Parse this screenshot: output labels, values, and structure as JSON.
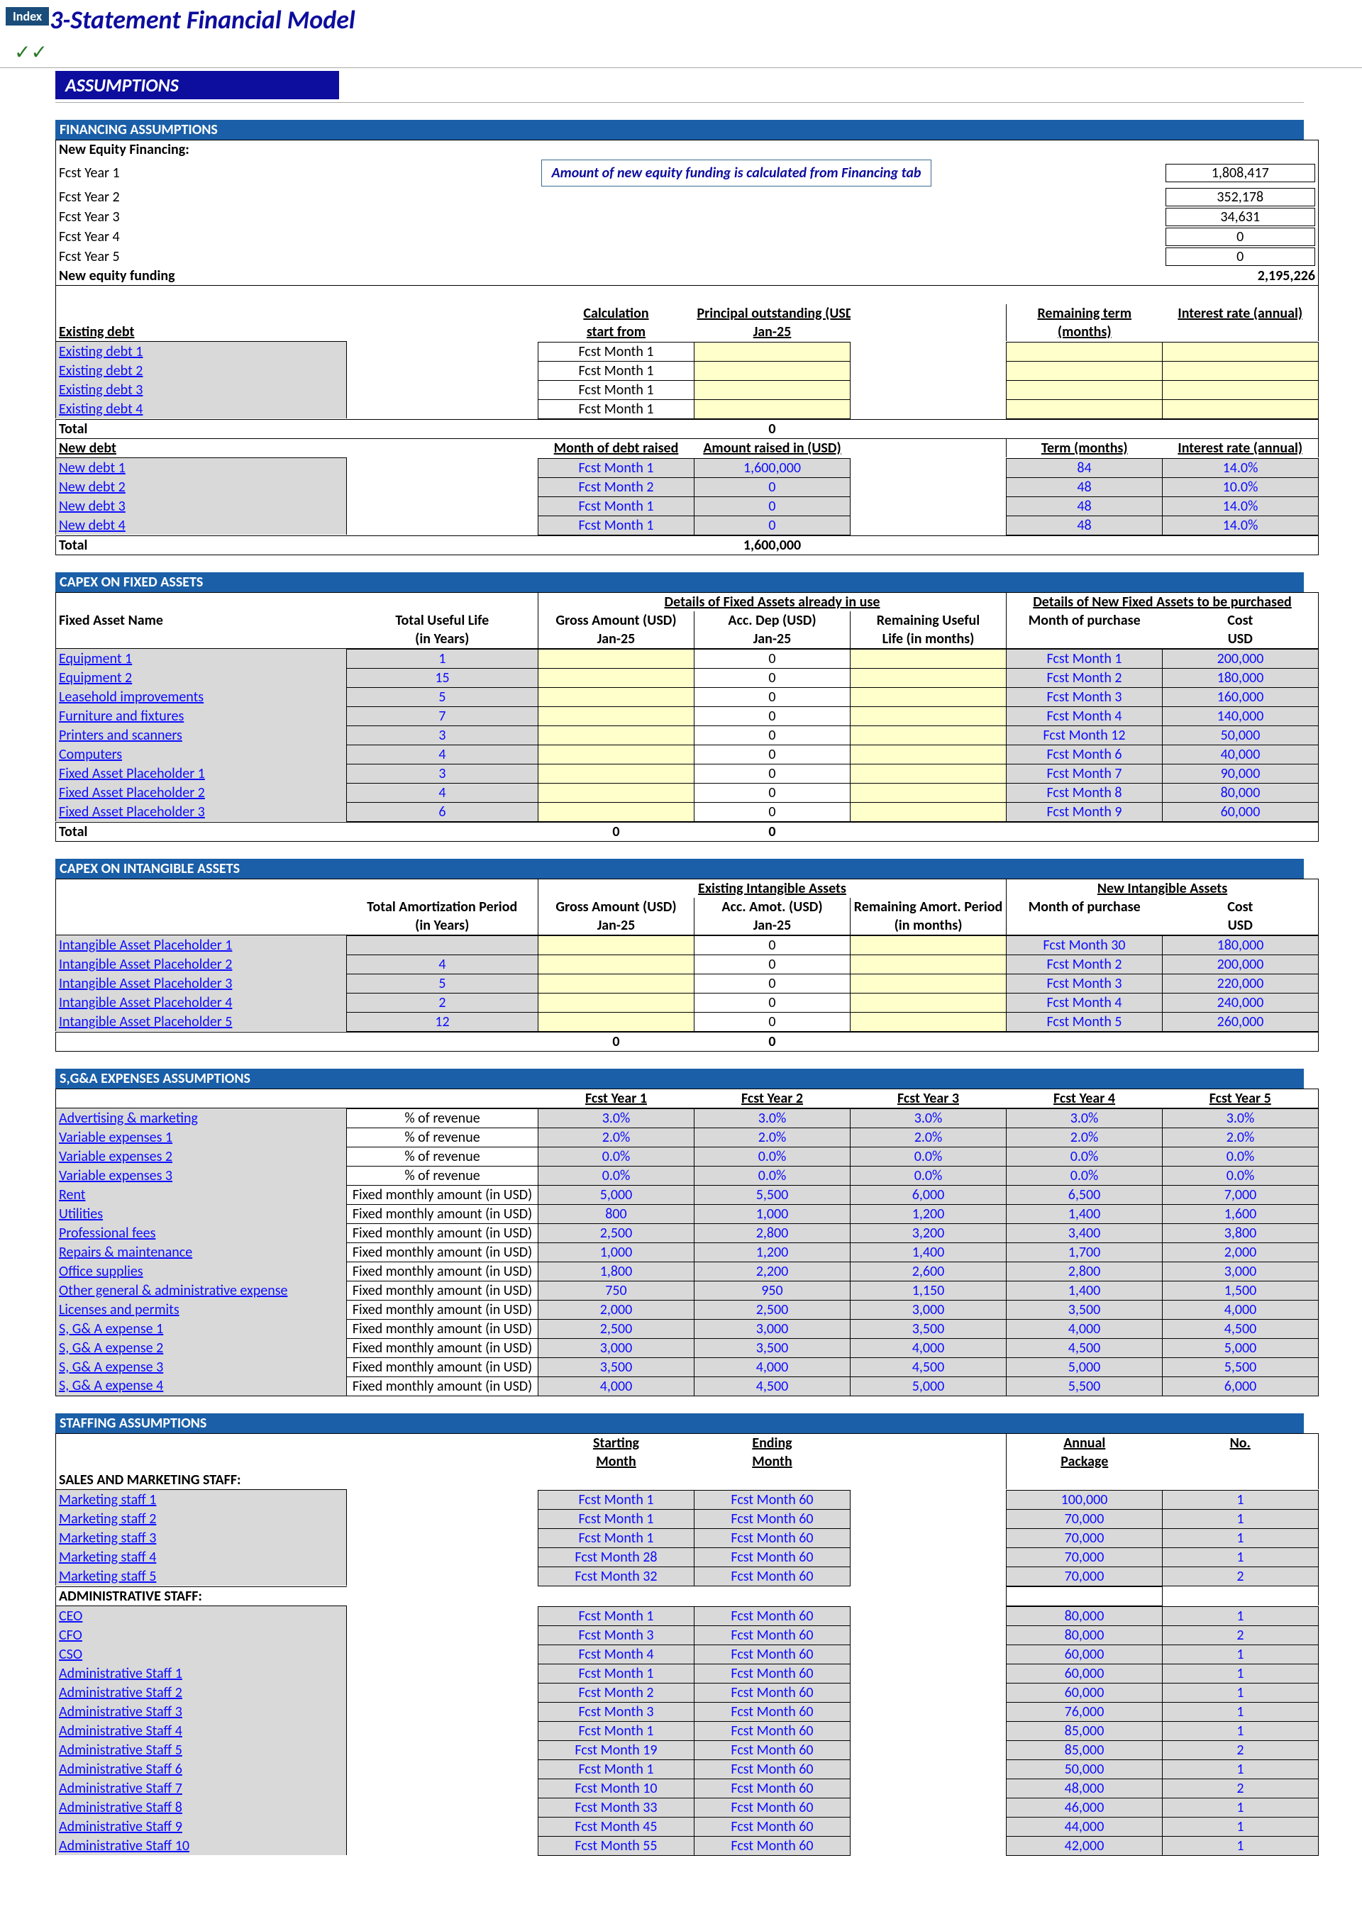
{
  "index_tab": "Index",
  "main_title": "3-Statement Financial Model",
  "assumptions_label": "ASSUMPTIONS",
  "financing": {
    "header": "FINANCING ASSUMPTIONS",
    "new_equity_label": "New Equity Financing:",
    "note": "Amount of new equity funding is calculated from Financing  tab",
    "rows": [
      {
        "label": "Fcst Year 1",
        "val": "1,808,417"
      },
      {
        "label": "Fcst Year 2",
        "val": "352,178"
      },
      {
        "label": "Fcst Year 3",
        "val": "34,631"
      },
      {
        "label": "Fcst Year 4",
        "val": "0"
      },
      {
        "label": "Fcst Year 5",
        "val": "0"
      }
    ],
    "new_equity_total_label": "New equity funding",
    "new_equity_total": "2,195,226",
    "existing_debt_label": "Existing debt",
    "ed_headers": {
      "c1": "Calculation",
      "c1b": "start from",
      "c2": "Principal outstanding (USD)",
      "c2b": "Jan-25",
      "c3": "Remaining term",
      "c3b": "(months)",
      "c4": "Interest rate (annual)"
    },
    "existing_debt_rows": [
      {
        "name": "Existing debt 1",
        "calc": "Fcst Month 1"
      },
      {
        "name": "Existing debt 2",
        "calc": "Fcst Month 1"
      },
      {
        "name": "Existing debt 3",
        "calc": "Fcst Month 1"
      },
      {
        "name": "Existing debt 4",
        "calc": "Fcst Month 1"
      }
    ],
    "ed_total_label": "Total",
    "ed_total": "0",
    "new_debt_label": "New debt",
    "nd_headers": {
      "c1": "Month of debt raised",
      "c2": "Amount raised in (USD)",
      "c3": "Term (months)",
      "c4": "Interest rate (annual)"
    },
    "new_debt_rows": [
      {
        "name": "New debt 1",
        "m": "Fcst Month 1",
        "amt": "1,600,000",
        "term": "84",
        "rate": "14.0%"
      },
      {
        "name": "New debt 2",
        "m": "Fcst Month 2",
        "amt": "0",
        "term": "48",
        "rate": "10.0%"
      },
      {
        "name": "New debt 3",
        "m": "Fcst Month 1",
        "amt": "0",
        "term": "48",
        "rate": "14.0%"
      },
      {
        "name": "New debt 4",
        "m": "Fcst Month 1",
        "amt": "0",
        "term": "48",
        "rate": "14.0%"
      }
    ],
    "nd_total_label": "Total",
    "nd_total": "1,600,000"
  },
  "capex_fixed": {
    "header": "CAPEX ON FIXED ASSETS",
    "col_headers": {
      "name": "Fixed Asset Name",
      "life": "Total Useful Life",
      "life2": "(in Years)",
      "g1": "Details of Fixed Assets already in use",
      "g2": "Details of New Fixed Assets to be purchased",
      "gross": "Gross Amount (USD)",
      "gross2": "Jan-25",
      "acc": "Acc. Dep (USD)",
      "acc2": "Jan-25",
      "rem": "Remaining Useful",
      "rem2": "Life (in months)",
      "mop": "Month of purchase",
      "cost": "Cost",
      "cost2": "USD"
    },
    "rows": [
      {
        "name": "Equipment 1",
        "life": "1",
        "acc": "0",
        "mop": "Fcst Month 1",
        "cost": "200,000"
      },
      {
        "name": "Equipment 2",
        "life": "15",
        "acc": "0",
        "mop": "Fcst Month 2",
        "cost": "180,000"
      },
      {
        "name": "Leasehold improvements",
        "life": "5",
        "acc": "0",
        "mop": "Fcst Month 3",
        "cost": "160,000"
      },
      {
        "name": "Furniture and fixtures",
        "life": "7",
        "acc": "0",
        "mop": "Fcst Month 4",
        "cost": "140,000"
      },
      {
        "name": "Printers and scanners",
        "life": "3",
        "acc": "0",
        "mop": "Fcst Month 12",
        "cost": "50,000"
      },
      {
        "name": "Computers",
        "life": "4",
        "acc": "0",
        "mop": "Fcst Month 6",
        "cost": "40,000"
      },
      {
        "name": "Fixed Asset Placeholder 1",
        "life": "3",
        "acc": "0",
        "mop": "Fcst Month 7",
        "cost": "90,000"
      },
      {
        "name": "Fixed Asset Placeholder 2",
        "life": "4",
        "acc": "0",
        "mop": "Fcst Month 8",
        "cost": "80,000"
      },
      {
        "name": "Fixed Asset Placeholder 3",
        "life": "6",
        "acc": "0",
        "mop": "Fcst Month 9",
        "cost": "60,000"
      }
    ],
    "total_label": "Total",
    "gross_total": "0",
    "acc_total": "0"
  },
  "capex_intangible": {
    "header": "CAPEX ON INTANGIBLE ASSETS",
    "col_headers": {
      "g1": "Existing Intangible Assets",
      "g2": "New Intangible Assets",
      "period": "Total Amortization Period",
      "period2": "(in Years)",
      "gross": "Gross Amount (USD)",
      "gross2": "Jan-25",
      "acc": "Acc. Amot. (USD)",
      "acc2": "Jan-25",
      "rem": "Remaining Amort. Period",
      "rem2": "(in months)",
      "mop": "Month of purchase",
      "cost": "Cost",
      "cost2": "USD"
    },
    "rows": [
      {
        "name": "Intangible Asset Placeholder 1",
        "period": "",
        "acc": "0",
        "mop": "Fcst Month 30",
        "cost": "180,000"
      },
      {
        "name": "Intangible Asset Placeholder 2",
        "period": "4",
        "acc": "0",
        "mop": "Fcst Month 2",
        "cost": "200,000"
      },
      {
        "name": "Intangible Asset Placeholder 3",
        "period": "5",
        "acc": "0",
        "mop": "Fcst Month 3",
        "cost": "220,000"
      },
      {
        "name": "Intangible Asset Placeholder 4",
        "period": "2",
        "acc": "0",
        "mop": "Fcst Month 4",
        "cost": "240,000"
      },
      {
        "name": "Intangible Asset Placeholder 5",
        "period": "12",
        "acc": "0",
        "mop": "Fcst Month 5",
        "cost": "260,000"
      }
    ],
    "gross_total": "0",
    "acc_total": "0"
  },
  "sga": {
    "header": "S,G&A EXPENSES ASSUMPTIONS",
    "year_headers": [
      "Fcst Year 1",
      "Fcst Year 2",
      "Fcst Year 3",
      "Fcst Year 4",
      "Fcst Year 5"
    ],
    "rows": [
      {
        "name": "Advertising & marketing",
        "type": "% of revenue",
        "v": [
          "3.0%",
          "3.0%",
          "3.0%",
          "3.0%",
          "3.0%"
        ]
      },
      {
        "name": "Variable expenses 1",
        "type": "% of revenue",
        "v": [
          "2.0%",
          "2.0%",
          "2.0%",
          "2.0%",
          "2.0%"
        ]
      },
      {
        "name": "Variable expenses 2",
        "type": "% of revenue",
        "v": [
          "0.0%",
          "0.0%",
          "0.0%",
          "0.0%",
          "0.0%"
        ]
      },
      {
        "name": "Variable expenses 3",
        "type": "% of revenue",
        "v": [
          "0.0%",
          "0.0%",
          "0.0%",
          "0.0%",
          "0.0%"
        ]
      },
      {
        "name": "Rent",
        "type": "Fixed monthly amount (in USD)",
        "v": [
          "5,000",
          "5,500",
          "6,000",
          "6,500",
          "7,000"
        ]
      },
      {
        "name": "Utilities",
        "type": "Fixed monthly amount (in USD)",
        "v": [
          "800",
          "1,000",
          "1,200",
          "1,400",
          "1,600"
        ]
      },
      {
        "name": "Professional fees",
        "type": "Fixed monthly amount (in USD)",
        "v": [
          "2,500",
          "2,800",
          "3,200",
          "3,400",
          "3,800"
        ]
      },
      {
        "name": "Repairs & maintenance",
        "type": "Fixed monthly amount (in USD)",
        "v": [
          "1,000",
          "1,200",
          "1,400",
          "1,700",
          "2,000"
        ]
      },
      {
        "name": "Office supplies",
        "type": "Fixed monthly amount (in USD)",
        "v": [
          "1,800",
          "2,200",
          "2,600",
          "2,800",
          "3,000"
        ]
      },
      {
        "name": "Other general & administrative expense",
        "type": "Fixed monthly amount (in USD)",
        "v": [
          "750",
          "950",
          "1,150",
          "1,400",
          "1,500"
        ]
      },
      {
        "name": "Licenses and permits",
        "type": "Fixed monthly amount (in USD)",
        "v": [
          "2,000",
          "2,500",
          "3,000",
          "3,500",
          "4,000"
        ]
      },
      {
        "name": "S, G& A expense 1",
        "type": "Fixed monthly amount (in USD)",
        "v": [
          "2,500",
          "3,000",
          "3,500",
          "4,000",
          "4,500"
        ]
      },
      {
        "name": "S, G& A expense 2",
        "type": "Fixed monthly amount (in USD)",
        "v": [
          "3,000",
          "3,500",
          "4,000",
          "4,500",
          "5,000"
        ]
      },
      {
        "name": "S, G& A expense 3",
        "type": "Fixed monthly amount (in USD)",
        "v": [
          "3,500",
          "4,000",
          "4,500",
          "5,000",
          "5,500"
        ]
      },
      {
        "name": "S, G& A expense 4",
        "type": "Fixed monthly amount (in USD)",
        "v": [
          "4,000",
          "4,500",
          "5,000",
          "5,500",
          "6,000"
        ]
      }
    ]
  },
  "staffing": {
    "header": "STAFFING ASSUMPTIONS",
    "col_headers": {
      "start": "Starting",
      "start2": "Month",
      "end": "Ending",
      "end2": "Month",
      "pkg": "Annual",
      "pkg2": "Package",
      "no": "No."
    },
    "sales_label": "SALES AND MARKETING STAFF:",
    "sales_rows": [
      {
        "name": "Marketing staff 1",
        "s": "Fcst Month 1",
        "e": "Fcst Month 60",
        "p": "100,000",
        "n": "1"
      },
      {
        "name": "Marketing staff 2",
        "s": "Fcst Month 1",
        "e": "Fcst Month 60",
        "p": "70,000",
        "n": "1"
      },
      {
        "name": "Marketing staff 3",
        "s": "Fcst Month 1",
        "e": "Fcst Month 60",
        "p": "70,000",
        "n": "1"
      },
      {
        "name": "Marketing staff 4",
        "s": "Fcst Month 28",
        "e": "Fcst Month 60",
        "p": "70,000",
        "n": "1"
      },
      {
        "name": "Marketing staff 5",
        "s": "Fcst Month 32",
        "e": "Fcst Month 60",
        "p": "70,000",
        "n": "2"
      }
    ],
    "admin_label": "ADMINISTRATIVE STAFF:",
    "admin_rows": [
      {
        "name": "CEO",
        "s": "Fcst Month 1",
        "e": "Fcst Month 60",
        "p": "80,000",
        "n": "1"
      },
      {
        "name": "CFO",
        "s": "Fcst Month 3",
        "e": "Fcst Month 60",
        "p": "80,000",
        "n": "2"
      },
      {
        "name": "CSO",
        "s": "Fcst Month 4",
        "e": "Fcst Month 60",
        "p": "60,000",
        "n": "1"
      },
      {
        "name": "Administrative Staff 1",
        "s": "Fcst Month 1",
        "e": "Fcst Month 60",
        "p": "60,000",
        "n": "1"
      },
      {
        "name": "Administrative Staff 2",
        "s": "Fcst Month 2",
        "e": "Fcst Month 60",
        "p": "60,000",
        "n": "1"
      },
      {
        "name": "Administrative Staff 3",
        "s": "Fcst Month 3",
        "e": "Fcst Month 60",
        "p": "76,000",
        "n": "1"
      },
      {
        "name": "Administrative Staff 4",
        "s": "Fcst Month 1",
        "e": "Fcst Month 60",
        "p": "85,000",
        "n": "1"
      },
      {
        "name": "Administrative Staff 5",
        "s": "Fcst Month 19",
        "e": "Fcst Month 60",
        "p": "85,000",
        "n": "2"
      },
      {
        "name": "Administrative Staff 6",
        "s": "Fcst Month 1",
        "e": "Fcst Month 60",
        "p": "50,000",
        "n": "1"
      },
      {
        "name": "Administrative Staff 7",
        "s": "Fcst Month 10",
        "e": "Fcst Month 60",
        "p": "48,000",
        "n": "2"
      },
      {
        "name": "Administrative Staff 8",
        "s": "Fcst Month 33",
        "e": "Fcst Month 60",
        "p": "46,000",
        "n": "1"
      },
      {
        "name": "Administrative Staff 9",
        "s": "Fcst Month 45",
        "e": "Fcst Month 60",
        "p": "44,000",
        "n": "1"
      },
      {
        "name": "Administrative Staff 10",
        "s": "Fcst Month 55",
        "e": "Fcst Month 60",
        "p": "42,000",
        "n": "1"
      }
    ]
  }
}
